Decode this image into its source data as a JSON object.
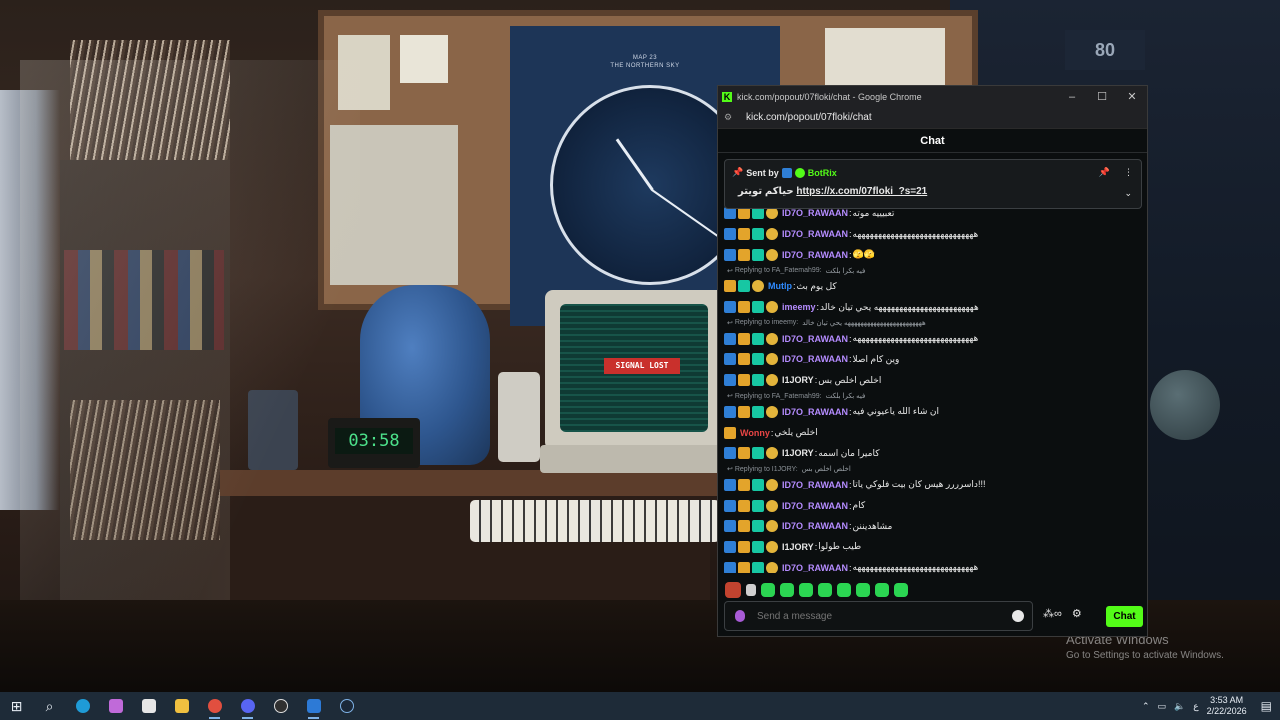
{
  "wallpaper": {
    "poster_text": "MAP 23\nTHE NORTHERN SKY",
    "clock_display": "03:58",
    "computer_status": "SIGNAL LOST",
    "wall_sign": "80"
  },
  "watermark": {
    "title": "Activate Windows",
    "subtitle": "Go to Settings to activate Windows."
  },
  "browser": {
    "window_title": "kick.com/popout/07floki/chat - Google Chrome",
    "url": "kick.com/popout/07floki/chat",
    "controls": {
      "minimize": "–",
      "maximize": "☐",
      "close": "✕"
    }
  },
  "chat": {
    "header": "Chat",
    "pinned": {
      "sent_by_label": "Sent by",
      "sender": "BotRix",
      "message_prefix": "حياكم تويتر",
      "link": "https://x.com/07floki_?s=21"
    },
    "messages": [
      {
        "type": "msg",
        "badges": [
          "mod",
          "crown",
          "sub",
          "gift"
        ],
        "user": "ID7O_RAWAAN",
        "color": "#b58cff",
        "text": "تعبيييه موته"
      },
      {
        "type": "msg",
        "badges": [
          "mod",
          "crown",
          "sub",
          "gift"
        ],
        "user": "ID7O_RAWAAN",
        "color": "#b58cff",
        "text": "هههههههههههههههههههههههههههههه"
      },
      {
        "type": "msg",
        "badges": [
          "mod",
          "crown",
          "sub",
          "gift"
        ],
        "user": "ID7O_RAWAAN",
        "color": "#b58cff",
        "text": "🫣🫣"
      },
      {
        "type": "reply",
        "text": "Replying to FA_Fatemah99:",
        "quote": "فيه بكرا بلكت"
      },
      {
        "type": "msg",
        "badges": [
          "crown",
          "sub",
          "gift"
        ],
        "user": "Mutlp",
        "color": "#2f8bff",
        "text": "كل يوم بث"
      },
      {
        "type": "msg",
        "badges": [
          "mod",
          "crown",
          "sub",
          "gift"
        ],
        "user": "imeemy",
        "color": "#b58cff",
        "text": "ههههههههههههههههههههههههه يحي تيان خالد"
      },
      {
        "type": "reply",
        "text": "Replying to imeemy:",
        "quote": "ههههههههههههههههههههههههه يحي تيان خالد"
      },
      {
        "type": "msg",
        "badges": [
          "mod",
          "crown",
          "sub",
          "gift"
        ],
        "user": "ID7O_RAWAAN",
        "color": "#b58cff",
        "text": "هههههههههههههههههههههههههههههه"
      },
      {
        "type": "msg",
        "badges": [
          "mod",
          "crown",
          "sub",
          "gift"
        ],
        "user": "ID7O_RAWAAN",
        "color": "#b58cff",
        "text": "وين كام اصلا"
      },
      {
        "type": "msg",
        "badges": [
          "mod",
          "crown",
          "sub",
          "gift"
        ],
        "user": "I1JORY",
        "color": "#e8e8e8",
        "text": "اخلص اخلص بس"
      },
      {
        "type": "reply",
        "text": "Replying to FA_Fatemah99:",
        "quote": "فيه بكرا بلكت"
      },
      {
        "type": "msg",
        "badges": [
          "mod",
          "crown",
          "sub",
          "gift"
        ],
        "user": "ID7O_RAWAAN",
        "color": "#b58cff",
        "text": "ان شاء الله ياعيوني فيه"
      },
      {
        "type": "msg",
        "badges": [
          "crown"
        ],
        "user": "Wonny",
        "color": "#e84545",
        "text": "اخلص يلخي"
      },
      {
        "type": "msg",
        "badges": [
          "mod",
          "crown",
          "sub",
          "gift"
        ],
        "user": "I1JORY",
        "color": "#e8e8e8",
        "text": "كاميرا مان اسمه"
      },
      {
        "type": "reply",
        "text": "Replying to I1JORY:",
        "quote": "اخلص اخلص بس"
      },
      {
        "type": "msg",
        "badges": [
          "mod",
          "crown",
          "sub",
          "gift"
        ],
        "user": "ID7O_RAWAAN",
        "color": "#b58cff",
        "text": "داسرررر هيس كان بيت فلوكي ياتا!!!"
      },
      {
        "type": "msg",
        "badges": [
          "mod",
          "crown",
          "sub",
          "gift"
        ],
        "user": "ID7O_RAWAAN",
        "color": "#b58cff",
        "text": "كام"
      },
      {
        "type": "msg",
        "badges": [
          "mod",
          "crown",
          "sub",
          "gift"
        ],
        "user": "ID7O_RAWAAN",
        "color": "#b58cff",
        "text": "مشاهديننن"
      },
      {
        "type": "msg",
        "badges": [
          "mod",
          "crown",
          "sub",
          "gift"
        ],
        "user": "I1JORY",
        "color": "#e8e8e8",
        "text": "طيب طولوا"
      },
      {
        "type": "msg",
        "badges": [
          "mod",
          "crown",
          "sub",
          "gift"
        ],
        "user": "ID7O_RAWAAN",
        "color": "#b58cff",
        "text": "هههههههههههههههههههههههههههههه"
      }
    ],
    "emotes": [
      "kick-emote",
      "hand-emote",
      "green-emote",
      "green-emote",
      "green-emote",
      "green-emote",
      "green-emote",
      "green-emote",
      "green-emote",
      "green-emote"
    ],
    "input_placeholder": "Send a message",
    "send_label": "Chat",
    "accent": "#53fc18"
  },
  "taskbar": {
    "apps": [
      "start-icon",
      "search-icon",
      "edge-icon",
      "copilot-icon",
      "store-icon",
      "explorer-icon",
      "chrome-icon",
      "discord-icon",
      "obs-icon",
      "app-icon",
      "steam-icon"
    ],
    "language": "ع",
    "time": "3:53 AM",
    "date": "2/22/2026"
  }
}
